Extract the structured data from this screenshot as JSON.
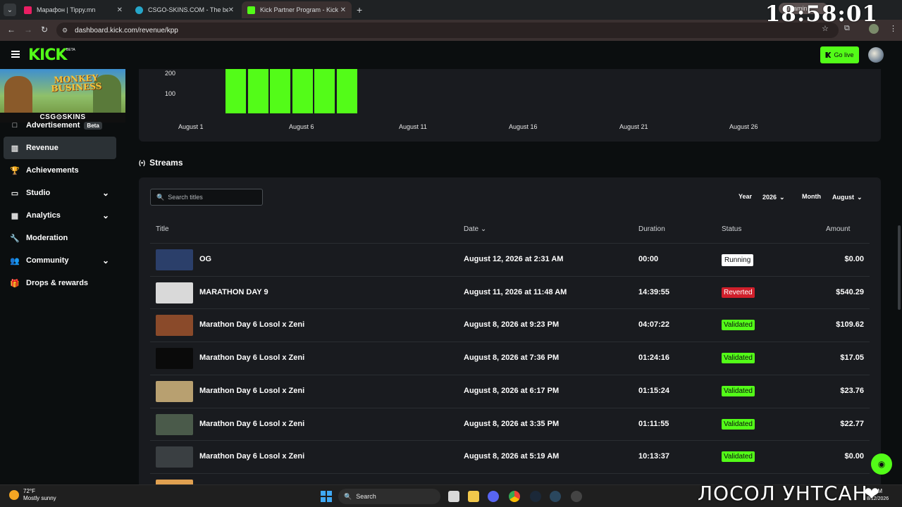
{
  "browser": {
    "tabs": [
      {
        "title": "Марафон | Tippy.mn",
        "fav": "#e91e63"
      },
      {
        "title": "CSGO-SKINS.COM - The best C",
        "fav": "#26a6c9"
      },
      {
        "title": "Kick Partner Program - Kick Da",
        "fav": "#53fc18"
      }
    ],
    "new_tab": "+",
    "url": "dashboard.kick.com/revenue/kpp",
    "clock": "18:58:01",
    "pill": "streamin"
  },
  "header": {
    "logo": "KICK",
    "logo_sup": "BETA",
    "go_live": "Go live"
  },
  "sidebar": {
    "banner": {
      "line1": "MONKEY",
      "line2": "BUSINESS",
      "sponsor": "CSG⊙SKINS"
    },
    "items": [
      {
        "label": "Advertisement",
        "badge": "Beta",
        "icon": "□"
      },
      {
        "label": "Revenue",
        "icon": "▥"
      },
      {
        "label": "Achievements",
        "icon": "🏆"
      },
      {
        "label": "Studio",
        "icon": "▭"
      },
      {
        "label": "Analytics",
        "icon": "▦"
      },
      {
        "label": "Moderation",
        "icon": "🔧"
      },
      {
        "label": "Community",
        "icon": "👥"
      },
      {
        "label": "Drops & rewards",
        "icon": "🎁"
      }
    ]
  },
  "revenue_chart": {
    "yticks": [
      "200",
      "100"
    ],
    "xticks": [
      "August 1",
      "August 6",
      "August 11",
      "August 16",
      "August 21",
      "August 26"
    ]
  },
  "chart_data": {
    "type": "bar",
    "categories": [
      "August 3",
      "August 4",
      "August 5",
      "August 6",
      "August 7",
      "August 8"
    ],
    "values": [
      245,
      245,
      245,
      245,
      245,
      245
    ],
    "ylim": [
      0,
      245
    ],
    "xlabel": "",
    "ylabel": ""
  },
  "streams": {
    "title": "Streams",
    "search_placeholder": "Search titles",
    "year_label": "Year",
    "year_value": "2026",
    "month_label": "Month",
    "month_value": "August",
    "columns": {
      "title": "Title",
      "date": "Date",
      "duration": "Duration",
      "status": "Status",
      "amount": "Amount"
    },
    "rows": [
      {
        "title": "OG",
        "date": "August 12, 2026 at 2:31 AM",
        "duration": "00:00",
        "status": "Running",
        "amount": "$0.00",
        "thumb": "#2b3f6a"
      },
      {
        "title": "MARATHON DAY 9",
        "date": "August 11, 2026 at 11:48 AM",
        "duration": "14:39:55",
        "status": "Reverted",
        "amount": "$540.29",
        "thumb": "#d9d9d9"
      },
      {
        "title": "Marathon Day 6 Losol x Zeni",
        "date": "August 8, 2026 at 9:23 PM",
        "duration": "04:07:22",
        "status": "Validated",
        "amount": "$109.62",
        "thumb": "#8a4a2a"
      },
      {
        "title": "Marathon Day 6 Losol x Zeni",
        "date": "August 8, 2026 at 7:36 PM",
        "duration": "01:24:16",
        "status": "Validated",
        "amount": "$17.05",
        "thumb": "#0a0a0a"
      },
      {
        "title": "Marathon Day 6 Losol x Zeni",
        "date": "August 8, 2026 at 6:17 PM",
        "duration": "01:15:24",
        "status": "Validated",
        "amount": "$23.76",
        "thumb": "#b8a070"
      },
      {
        "title": "Marathon Day 6 Losol x Zeni",
        "date": "August 8, 2026 at 3:35 PM",
        "duration": "01:11:55",
        "status": "Validated",
        "amount": "$22.77",
        "thumb": "#4a5a4a"
      },
      {
        "title": "Marathon Day 6 Losol x Zeni",
        "date": "August 8, 2026 at 5:19 AM",
        "duration": "10:13:37",
        "status": "Validated",
        "amount": "$0.00",
        "thumb": "#3a3f42"
      }
    ]
  },
  "taskbar": {
    "temp": "72°F",
    "weather": "Mostly sunny",
    "search": "Search",
    "time": "PM",
    "date": "8/12/2026"
  },
  "overlay": {
    "text": "ЛОСОЛ УНТСАН"
  },
  "colors": {
    "accent": "#53fc18",
    "reverted": "#d01f2b",
    "bg": "#0b0e0f",
    "card": "#191b1f"
  }
}
